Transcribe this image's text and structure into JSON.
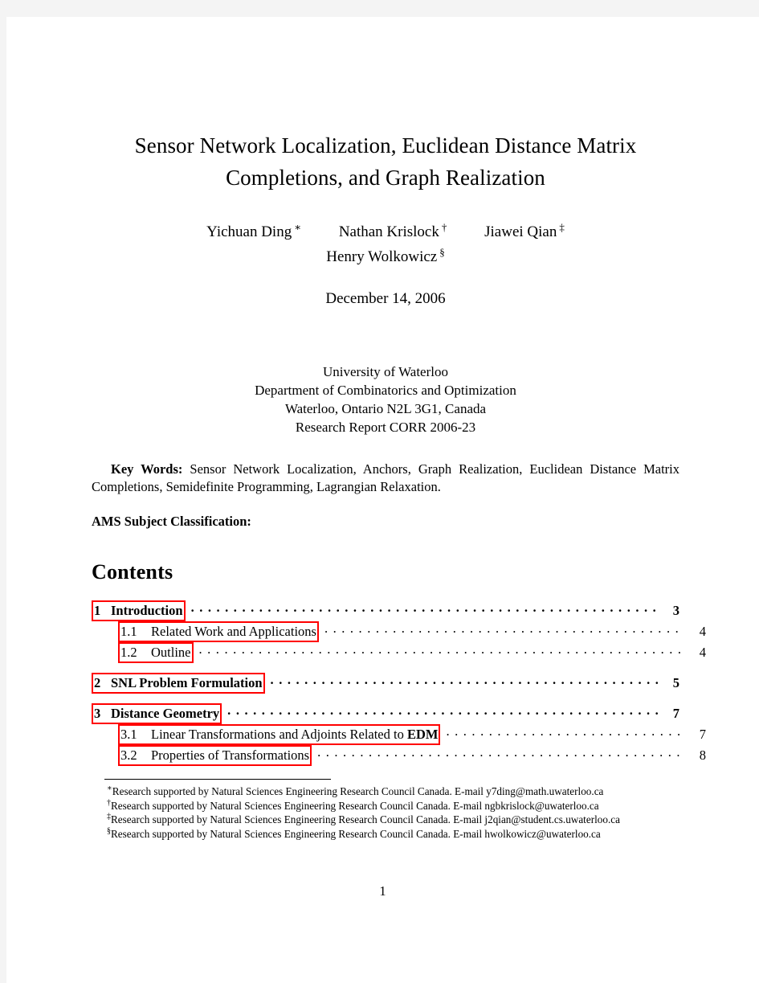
{
  "document": {
    "title_line1": "Sensor Network Localization, Euclidean Distance Matrix",
    "title_line2": "Completions, and Graph Realization",
    "date": "December 14, 2006",
    "page_number": "1"
  },
  "authors": {
    "row1": [
      {
        "name": "Yichuan Ding",
        "mark": "∗"
      },
      {
        "name": "Nathan Krislock",
        "mark": "†"
      },
      {
        "name": "Jiawei Qian",
        "mark": "‡"
      }
    ],
    "row2": [
      {
        "name": "Henry Wolkowicz",
        "mark": "§"
      }
    ]
  },
  "affiliation": {
    "line1": "University of Waterloo",
    "line2": "Department of Combinatorics and Optimization",
    "line3": "Waterloo, Ontario N2L 3G1, Canada",
    "line4": "Research Report CORR 2006-23"
  },
  "keywords": {
    "label": "Key Words:",
    "text": "Sensor Network Localization, Anchors, Graph Realization, Euclidean Distance Matrix Completions, Semidefinite Programming, Lagrangian Relaxation.",
    "ams_label": "AMS Subject Classification:"
  },
  "contents": {
    "heading": "Contents",
    "entries": [
      {
        "level": "section",
        "number": "1",
        "title": "Introduction",
        "page": "3",
        "bold_tail": ""
      },
      {
        "level": "sub",
        "number": "1.1",
        "title": "Related Work and Applications",
        "page": "4",
        "bold_tail": ""
      },
      {
        "level": "sub",
        "number": "1.2",
        "title": "Outline",
        "page": "4",
        "bold_tail": ""
      },
      {
        "level": "section",
        "number": "2",
        "title": "SNL Problem Formulation",
        "page": "5",
        "bold_tail": ""
      },
      {
        "level": "section",
        "number": "3",
        "title": "Distance Geometry",
        "page": "7",
        "bold_tail": ""
      },
      {
        "level": "sub",
        "number": "3.1",
        "title": "Linear Transformations and Adjoints Related to ",
        "page": "7",
        "bold_tail": "EDM"
      },
      {
        "level": "sub",
        "number": "3.2",
        "title": "Properties of Transformations",
        "page": "8",
        "bold_tail": ""
      }
    ]
  },
  "footnotes": [
    {
      "mark": "∗",
      "text": "Research supported by Natural Sciences Engineering Research Council Canada. E-mail y7ding@math.uwaterloo.ca"
    },
    {
      "mark": "†",
      "text": "Research supported by Natural Sciences Engineering Research Council Canada. E-mail ngbkrislock@uwaterloo.ca"
    },
    {
      "mark": "‡",
      "text": "Research supported by Natural Sciences Engineering Research Council Canada. E-mail j2qian@student.cs.uwaterloo.ca"
    },
    {
      "mark": "§",
      "text": "Research supported by Natural Sciences Engineering Research Council Canada. E-mail hwolkowicz@uwaterloo.ca"
    }
  ],
  "colors": {
    "link_box": "#ff0000",
    "page_background": "#ffffff",
    "viewer_background": "#f4f4f4",
    "text": "#000000"
  }
}
